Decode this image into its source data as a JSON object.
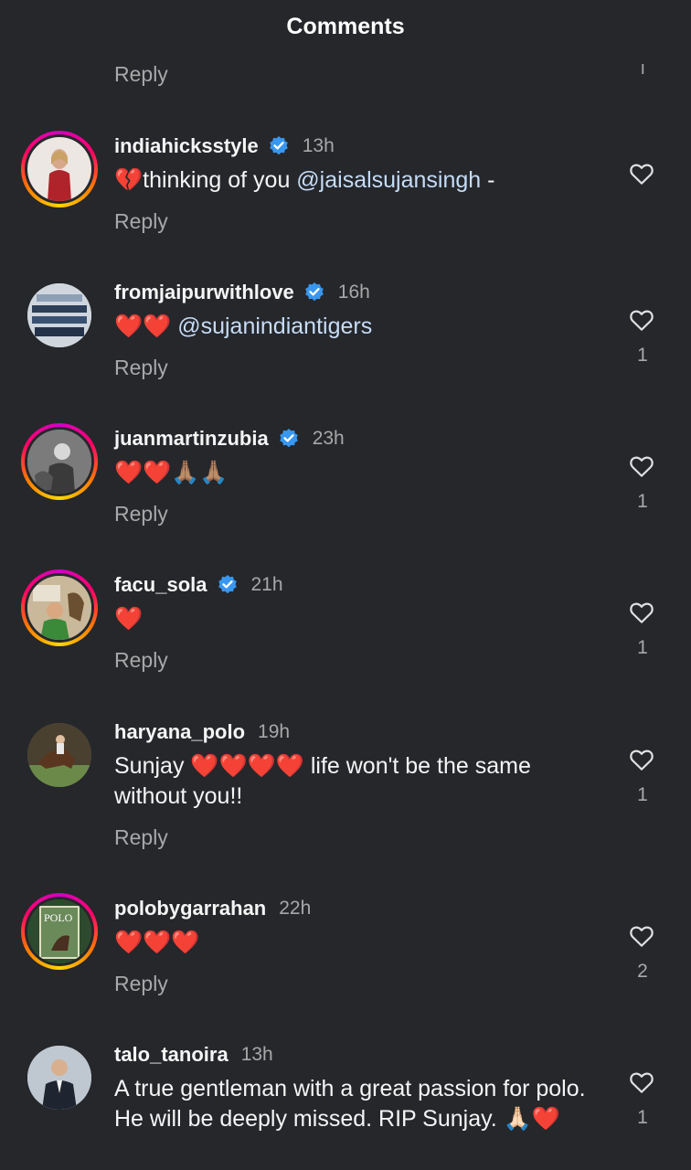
{
  "header": {
    "title": "Comments"
  },
  "top": {
    "reply": "Reply",
    "count": "ı"
  },
  "comments": [
    {
      "username": "indiahicksstyle",
      "verified": true,
      "time": "13h",
      "text_before": "💔thinking of you ",
      "mention": "@jaisalsujansingh",
      "text_after": " -",
      "reply": "Reply",
      "likes": ""
    },
    {
      "username": "fromjaipurwithlove",
      "verified": true,
      "time": "16h",
      "text_before": "❤️❤️ ",
      "mention": "@sujanindiantigers",
      "text_after": "",
      "reply": "Reply",
      "likes": "1"
    },
    {
      "username": "juanmartinzubia",
      "verified": true,
      "time": "23h",
      "text_before": "❤️❤️🙏🏽🙏🏽",
      "mention": "",
      "text_after": "",
      "reply": "Reply",
      "likes": "1"
    },
    {
      "username": "facu_sola",
      "verified": true,
      "time": "21h",
      "text_before": "❤️",
      "mention": "",
      "text_after": "",
      "reply": "Reply",
      "likes": "1"
    },
    {
      "username": "haryana_polo",
      "verified": false,
      "time": "19h",
      "text_before": "Sunjay ❤️❤️❤️❤️ life won't be the same without you!!",
      "mention": "",
      "text_after": "",
      "reply": "Reply",
      "likes": "1"
    },
    {
      "username": "polobygarrahan",
      "verified": false,
      "time": "22h",
      "text_before": "❤️❤️❤️",
      "mention": "",
      "text_after": "",
      "reply": "Reply",
      "likes": "2"
    },
    {
      "username": "talo_tanoira",
      "verified": false,
      "time": "13h",
      "text_before": "A true gentleman with a great passion for polo. He will be deeply missed. RIP Sunjay. 🙏🏻❤️",
      "mention": "",
      "text_after": "",
      "reply": "",
      "likes": "1"
    }
  ],
  "colors": {
    "background": "#25272b",
    "verified": "#3897f0",
    "mention": "#c6dcf7",
    "secondary": "#a8a8a8"
  },
  "icons": {
    "like": "heart-outline-icon",
    "verified": "verified-badge-icon"
  }
}
